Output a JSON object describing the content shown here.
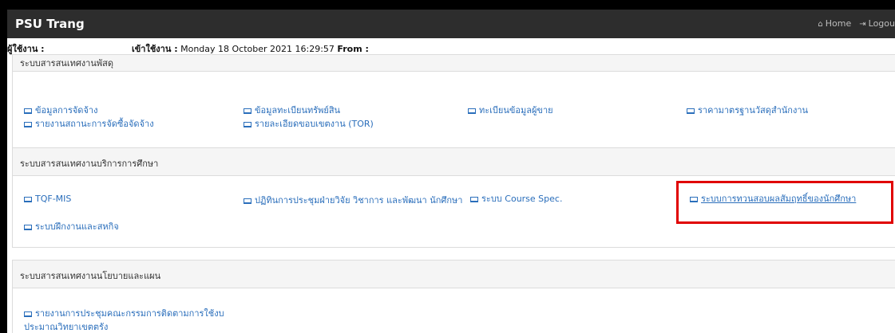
{
  "navbar": {
    "brand": "PSU Trang",
    "home_label": "Home",
    "logout_label": "Logou"
  },
  "userbar": {
    "user_label": "ผู้ใช้งาน :",
    "login_label": "เข้าใช้งาน :",
    "login_time": "Monday 18 October 2021 16:29:57",
    "from_label": "From :"
  },
  "panels": [
    {
      "title": "ระบบสารสนเทศงานพัสดุ",
      "links": [
        "ข้อมูลการจัดจ้าง",
        "รายงานสถานะการจัดซื้อจัดจ้าง",
        "ข้อมูลทะเบียนทรัพย์สิน",
        "รายละเอียดขอบเขตงาน (TOR)",
        "ทะเบียนข้อมูลผู้ขาย",
        "ราคามาตรฐานวัสดุสำนักงาน"
      ]
    },
    {
      "title": "ระบบสารสนเทศงานบริการการศึกษา",
      "links": [
        "TQF-MIS",
        "ระบบฝึกงานและสหกิจ",
        "ปฏิทินการประชุมฝ่ายวิจัย วิชาการ และพัฒนา นักศึกษา",
        "ระบบ Course Spec.",
        "ระบบการทวนสอบผลสัมฤทธิ์ของนักศึกษา"
      ]
    },
    {
      "title": "ระบบสารสนเทศงานนโยบายและแผน",
      "links": [
        "รายงานการประชุมคณะกรรมการติดตามการใช้งบประมาณวิทยาเขตตรัง"
      ]
    }
  ],
  "colors": {
    "navbar": "#2d2d2d",
    "link": "#2a6ebb",
    "highlight": "#e00000"
  }
}
